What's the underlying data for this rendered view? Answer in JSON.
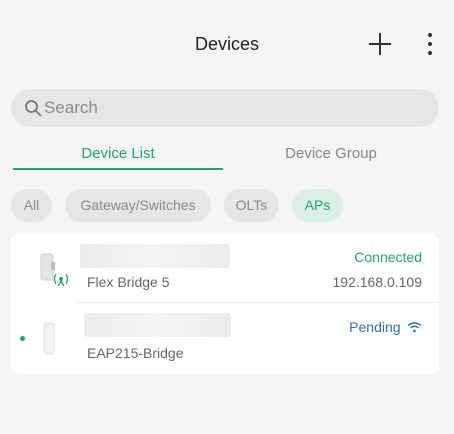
{
  "header": {
    "title": "Devices",
    "add_icon": "plus-icon",
    "more_icon": "more-vertical-icon"
  },
  "search": {
    "placeholder": "Search",
    "value": "",
    "icon": "search-icon"
  },
  "tabs": [
    {
      "label": "Device List",
      "active": true
    },
    {
      "label": "Device Group",
      "active": false
    }
  ],
  "filters": [
    {
      "label": "All",
      "active": false
    },
    {
      "label": "Gateway/Switches",
      "active": false
    },
    {
      "label": "OLTs",
      "active": false
    },
    {
      "label": "APs",
      "active": true
    }
  ],
  "devices": [
    {
      "name": "Flex Bridge 5",
      "status": "Connected",
      "ip": "192.168.0.109",
      "icon": "outdoor-ap-icon"
    },
    {
      "name": "EAP215-Bridge",
      "status": "Pending",
      "status_icon": "wifi-icon",
      "icon": "ap-device-icon"
    }
  ],
  "colors": {
    "accent": "#24a36a",
    "pending": "#2f6fb5",
    "background": "#f5f5f5"
  }
}
